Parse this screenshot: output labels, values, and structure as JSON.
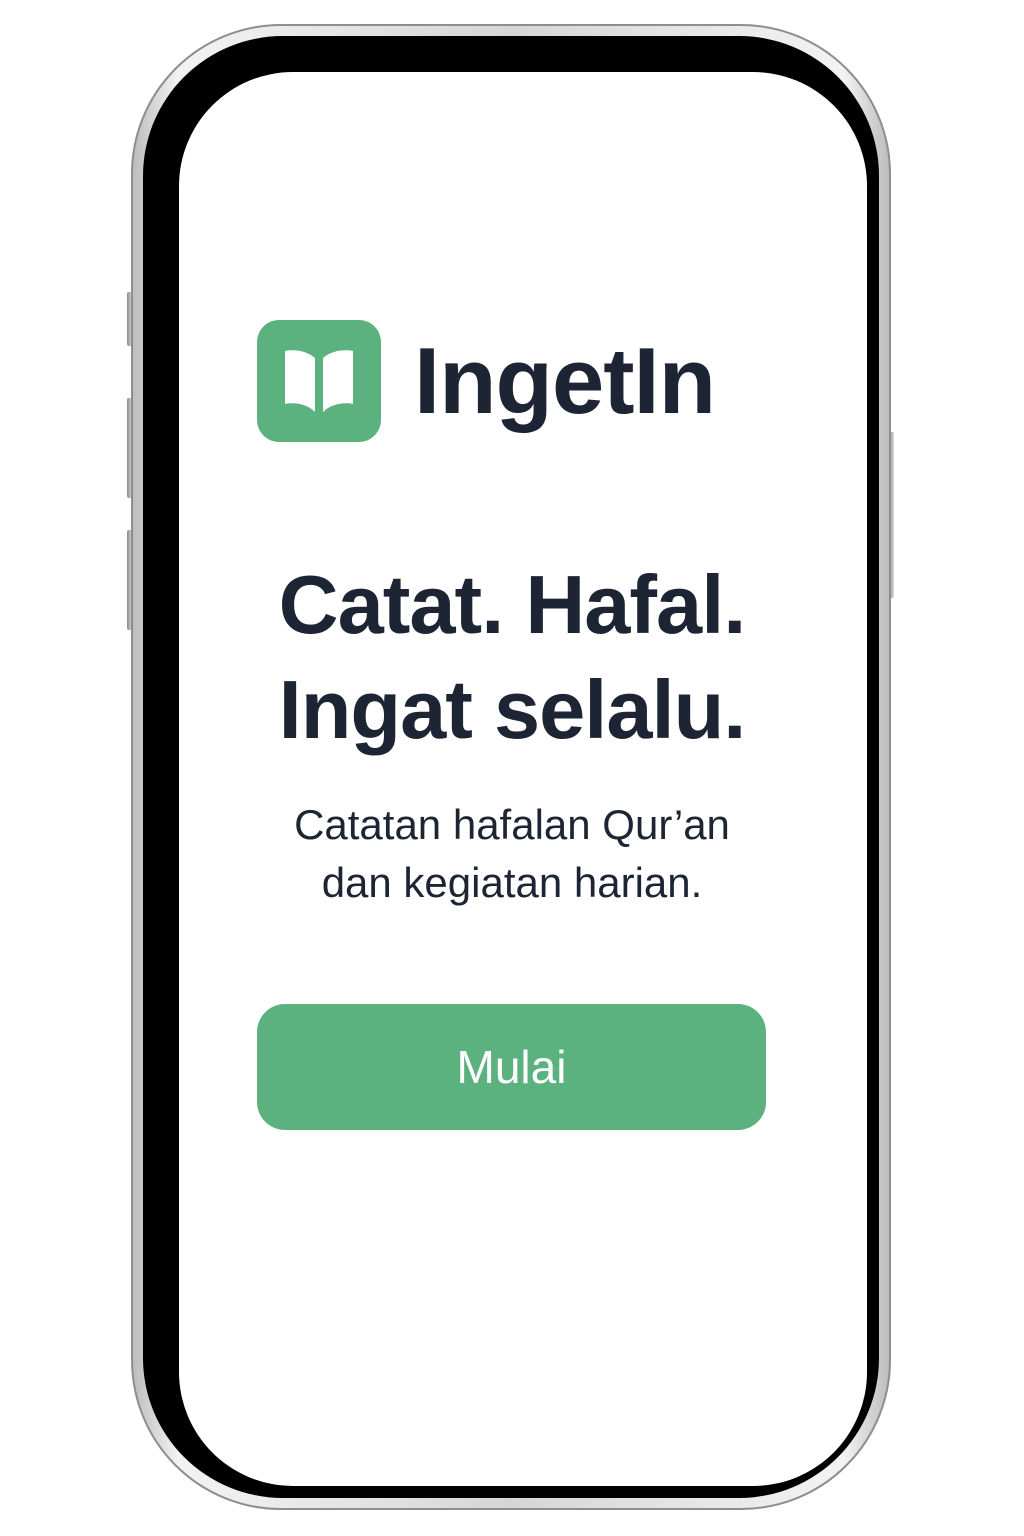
{
  "app": {
    "name": "IngetIn",
    "logo_icon": "open-book-icon",
    "accent_color": "#5cb27e",
    "text_color": "#1d2433"
  },
  "hero": {
    "headline_line1": "Catat. Hafal.",
    "headline_line2": "Ingat selalu.",
    "subtitle_line1": "Catatan hafalan Qur’an",
    "subtitle_line2": "dan kegiatan harian."
  },
  "actions": {
    "start_label": "Mulai"
  }
}
